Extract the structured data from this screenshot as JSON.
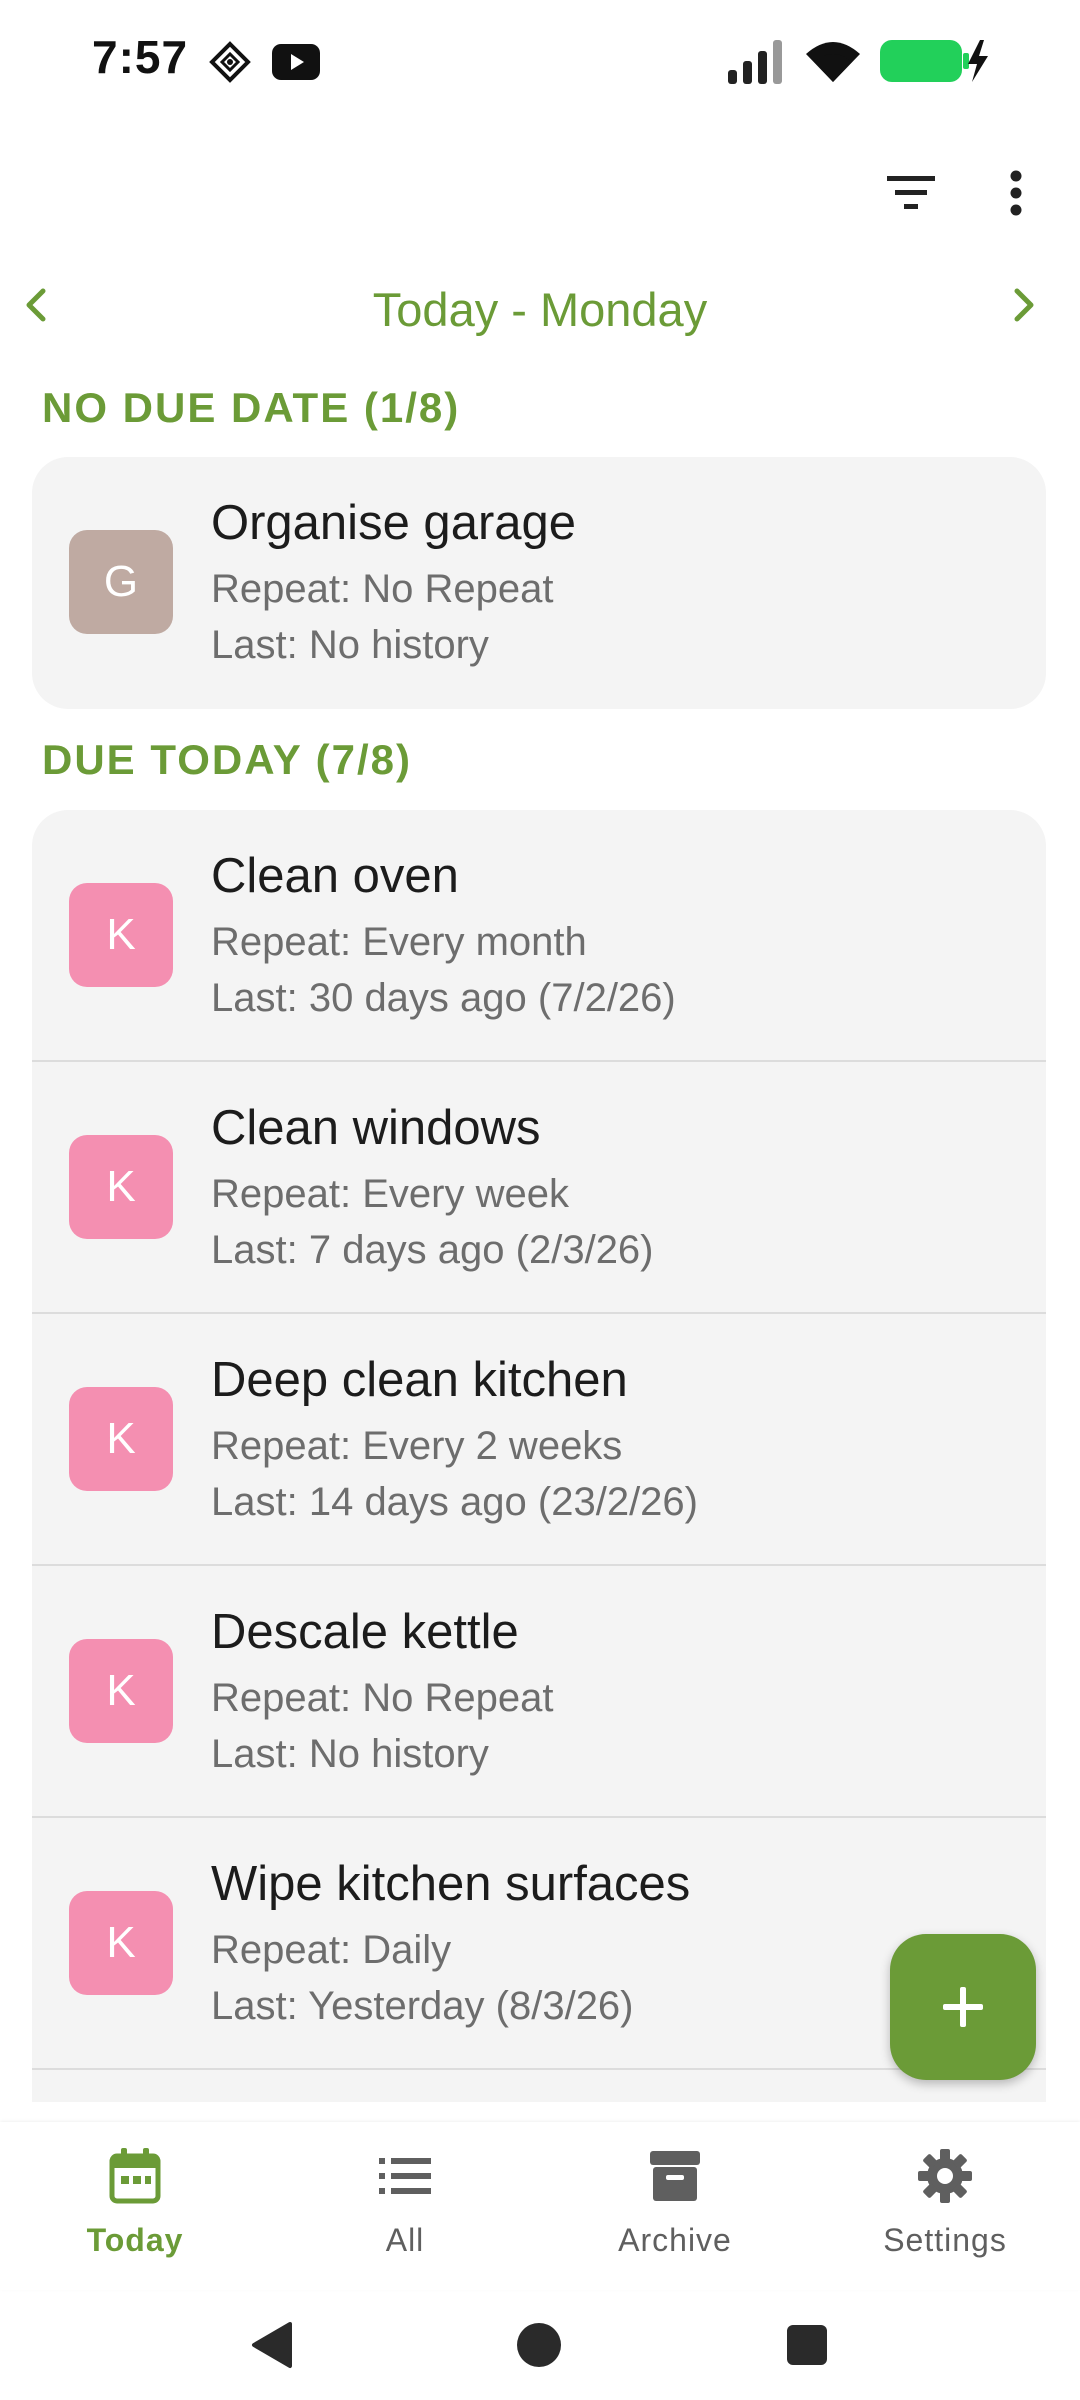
{
  "status_bar": {
    "time": "7:57",
    "icons": [
      "tidy-app-icon",
      "youtube-icon",
      "signal-icon",
      "wifi-icon",
      "battery-charging-icon"
    ]
  },
  "toolbar": {
    "icons": [
      "filter-icon",
      "more-vert-icon"
    ]
  },
  "date_nav": {
    "title": "Today - Monday",
    "prev_icon": "chevron-left-icon",
    "next_icon": "chevron-right-icon"
  },
  "sections": [
    {
      "header": "NO DUE DATE (1/8)",
      "tasks": [
        {
          "initial": "G",
          "title": "Organise garage",
          "repeat": "Repeat: No Repeat",
          "last": "Last: No history",
          "color": "#bfaaa2"
        }
      ]
    },
    {
      "header": "DUE TODAY (7/8)",
      "tasks": [
        {
          "initial": "K",
          "title": "Clean oven",
          "repeat": "Repeat: Every month",
          "last": "Last: 30 days ago (7/2/26)",
          "color": "#f48fb1"
        },
        {
          "initial": "K",
          "title": "Clean windows",
          "repeat": "Repeat: Every week",
          "last": "Last: 7 days ago (2/3/26)",
          "color": "#f48fb1"
        },
        {
          "initial": "K",
          "title": "Deep clean kitchen",
          "repeat": "Repeat: Every 2 weeks",
          "last": "Last: 14 days ago (23/2/26)",
          "color": "#f48fb1"
        },
        {
          "initial": "K",
          "title": "Descale kettle",
          "repeat": "Repeat: No Repeat",
          "last": "Last: No history",
          "color": "#f48fb1"
        },
        {
          "initial": "K",
          "title": "Wipe kitchen surfaces",
          "repeat": "Repeat: Daily",
          "last": "Last: Yesterday (8/3/26)",
          "color": "#f48fb1"
        }
      ]
    }
  ],
  "fab": {
    "icon": "plus-icon"
  },
  "bottom_nav": [
    {
      "label": "Today",
      "icon": "calendar-icon",
      "active": true
    },
    {
      "label": "All",
      "icon": "list-icon",
      "active": false
    },
    {
      "label": "Archive",
      "icon": "archive-icon",
      "active": false
    },
    {
      "label": "Settings",
      "icon": "gear-icon",
      "active": false
    }
  ],
  "colors": {
    "accent": "#6b9b37",
    "avatar_pink": "#f48fb1",
    "avatar_taupe": "#bfaaa2",
    "card_bg": "#f4f4f4"
  }
}
